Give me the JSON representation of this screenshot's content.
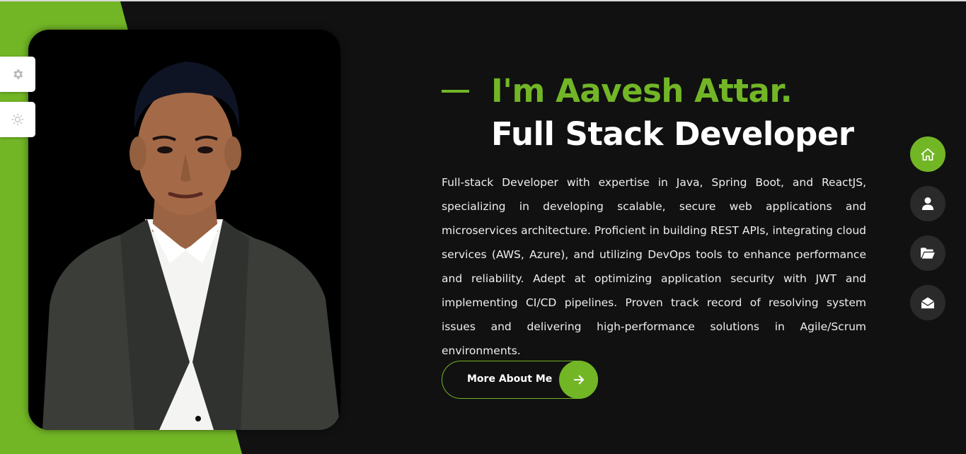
{
  "hero": {
    "greeting": "I'm Aavesh Attar.",
    "role": "Full Stack Developer",
    "bio": "Full-stack Developer with expertise in Java, Spring Boot, and ReactJS, specializing in developing scalable, secure web applications and microservices architecture. Proficient in building REST APIs, integrating cloud services (AWS, Azure), and utilizing DevOps tools to enhance performance and reliability. Adept at optimizing application security with JWT and implementing CI/CD pipelines. Proven track record of resolving system issues and delivering high-performance solutions in Agile/Scrum environments.",
    "cta_label": "More About Me",
    "cta_icon": "arrow-right-icon"
  },
  "profile_photo": {
    "alt": "Portrait of Aavesh Attar"
  },
  "side_tools": [
    {
      "icon": "gear-icon"
    },
    {
      "icon": "sun-icon"
    }
  ],
  "nav": [
    {
      "icon": "home-icon",
      "active": true
    },
    {
      "icon": "user-icon",
      "active": false
    },
    {
      "icon": "folder-icon",
      "active": false
    },
    {
      "icon": "envelope-icon",
      "active": false
    }
  ],
  "colors": {
    "accent": "#72b626",
    "background": "#111111",
    "nav_inactive": "#2b2a2a",
    "text": "#ffffff"
  }
}
